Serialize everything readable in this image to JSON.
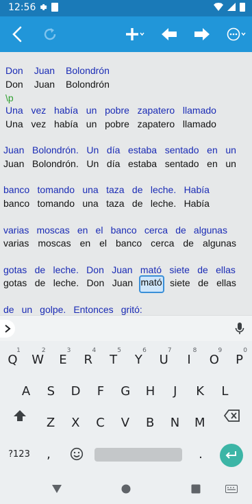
{
  "status_bar": {
    "time": "12:56"
  },
  "toolbar": {
    "back_icon": "arrow-back-icon",
    "redo_icon": "refresh-icon",
    "add_icon": "plus-dropdown-icon",
    "prev_icon": "arrow-left-icon",
    "next_icon": "arrow-right-icon",
    "more_icon": "more-options-icon"
  },
  "editor": {
    "lines": [
      {
        "type": "gloss",
        "words": [
          "Don",
          "Juan",
          "Bolondrón"
        ]
      },
      {
        "type": "text",
        "words": [
          "Don",
          "Juan",
          "Bolondrón"
        ]
      },
      {
        "type": "marker",
        "words": [
          "\\p"
        ]
      },
      {
        "type": "gloss",
        "words": [
          "Una",
          "vez",
          "había",
          "un",
          "pobre",
          "zapatero",
          "llamado"
        ]
      },
      {
        "type": "text",
        "words": [
          "Una",
          "vez",
          "había",
          "un",
          "pobre",
          "zapatero",
          "llamado"
        ]
      },
      {
        "type": "gloss",
        "words": [
          "Juan",
          "Bolondrón.",
          "Un",
          "día",
          "estaba",
          "sentado",
          "en",
          "un"
        ]
      },
      {
        "type": "text",
        "words": [
          "Juan",
          "Bolondrón.",
          "Un",
          "día",
          "estaba",
          "sentado",
          "en",
          "un"
        ]
      },
      {
        "type": "gloss",
        "words": [
          "banco",
          "tomando",
          "una",
          "taza",
          "de",
          "leche.",
          "Había"
        ]
      },
      {
        "type": "text",
        "words": [
          "banco",
          "tomando",
          "una",
          "taza",
          "de",
          "leche.",
          "Había"
        ]
      },
      {
        "type": "gloss",
        "words": [
          "varias",
          "moscas",
          "en",
          "el",
          "banco",
          "cerca",
          "de",
          "algunas"
        ]
      },
      {
        "type": "text",
        "words": [
          "varias",
          "moscas",
          "en",
          "el",
          "banco",
          "cerca",
          "de",
          "algunas"
        ]
      },
      {
        "type": "gloss",
        "words": [
          "gotas",
          "de",
          "leche.",
          "Don",
          "Juan",
          "mató",
          "siete",
          "de",
          "ellas"
        ]
      },
      {
        "type": "text",
        "words": [
          "gotas",
          "de",
          "leche.",
          "Don",
          "Juan",
          "mató",
          "siete",
          "de",
          "ellas"
        ],
        "selected_index": 5
      },
      {
        "type": "gloss",
        "words": [
          "de",
          "un",
          "golpe.",
          "Entonces",
          "gritó:"
        ]
      }
    ]
  },
  "keyboard": {
    "row1": [
      {
        "label": "Q",
        "hint": "1"
      },
      {
        "label": "W",
        "hint": "2"
      },
      {
        "label": "E",
        "hint": "3"
      },
      {
        "label": "R",
        "hint": "4"
      },
      {
        "label": "T",
        "hint": "5"
      },
      {
        "label": "Y",
        "hint": "6"
      },
      {
        "label": "U",
        "hint": "7"
      },
      {
        "label": "I",
        "hint": "8"
      },
      {
        "label": "O",
        "hint": "9"
      },
      {
        "label": "P",
        "hint": "0"
      }
    ],
    "row2": [
      "A",
      "S",
      "D",
      "F",
      "G",
      "H",
      "J",
      "K",
      "L"
    ],
    "row3": [
      "Z",
      "X",
      "C",
      "V",
      "B",
      "N",
      "M"
    ],
    "symbols_label": "?123",
    "comma": ",",
    "period": ".",
    "expand_icon": "chevron-right-icon",
    "mic_icon": "microphone-icon"
  },
  "colors": {
    "status_bar": "#1a7ab8",
    "toolbar": "#2196d9",
    "gloss_text": "#1a2bb5",
    "editor_bg": "#e6e8e9",
    "enter_key": "#3cb5a6"
  }
}
